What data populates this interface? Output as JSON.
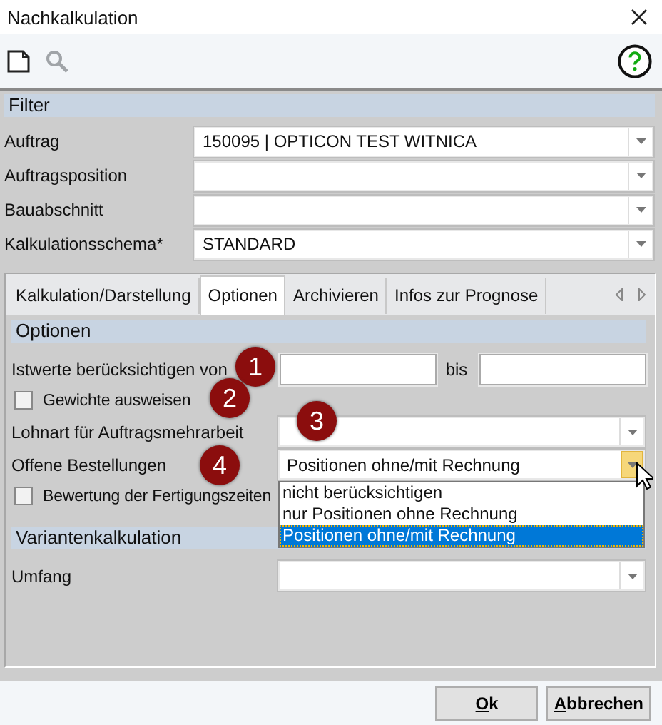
{
  "window": {
    "title": "Nachkalkulation"
  },
  "filter": {
    "title": "Filter",
    "fields": [
      {
        "label": "Auftrag",
        "value": "150095 | OPTICON TEST WITNICA"
      },
      {
        "label": "Auftragsposition"
      },
      {
        "label": "Bauabschnitt"
      },
      {
        "label": "Kalkulationsschema*",
        "value": "STANDARD"
      }
    ]
  },
  "tabs": [
    {
      "label": "Kalkulation/Darstellung",
      "selected": false
    },
    {
      "label": "Optionen",
      "selected": true
    },
    {
      "label": "Archivieren",
      "selected": false
    },
    {
      "label": "Infos zur Prognose",
      "selected": false
    }
  ],
  "options": {
    "title": "Optionen",
    "rows": [
      {
        "kind": "range",
        "label": "Istwerte berücksichtigen von",
        "separator": "bis"
      },
      {
        "kind": "checkbox",
        "label": "Gewichte ausweisen",
        "checked": false
      },
      {
        "kind": "combo",
        "label": "Lohnart für Auftragsmehrarbeit"
      },
      {
        "kind": "combo",
        "label": "Offene Bestellungen",
        "value": "Positionen ohne/mit Rechnung",
        "open": true,
        "options": [
          {
            "label": "nicht berücksichtigen",
            "selected": false
          },
          {
            "label": "nur Positionen ohne Rechnung",
            "selected": false
          },
          {
            "label": "Positionen ohne/mit Rechnung",
            "selected": true
          }
        ]
      },
      {
        "kind": "checkbox",
        "label": "Bewertung der Fertigungszeiten",
        "checked": false
      }
    ]
  },
  "variants": {
    "title": "Variantenkalkulation",
    "rows": [
      {
        "kind": "combo",
        "label": "Umfang"
      }
    ]
  },
  "callouts": [
    "1",
    "2",
    "3",
    "4"
  ],
  "buttons": [
    {
      "label": "Ok"
    },
    {
      "label": "Abbrechen"
    }
  ]
}
